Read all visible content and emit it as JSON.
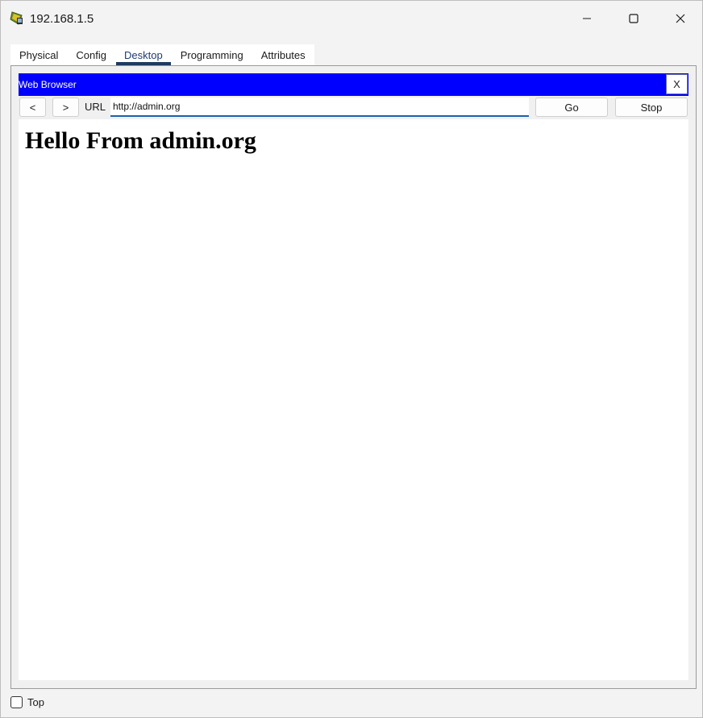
{
  "window": {
    "title": "192.168.1.5",
    "icon": "packet-tracer-pc-icon"
  },
  "window_controls": {
    "minimize_icon": "minimize-icon",
    "maximize_icon": "maximize-icon",
    "close_icon": "close-icon"
  },
  "tabs": [
    {
      "label": "Physical",
      "active": false
    },
    {
      "label": "Config",
      "active": false
    },
    {
      "label": "Desktop",
      "active": true
    },
    {
      "label": "Programming",
      "active": false
    },
    {
      "label": "Attributes",
      "active": false
    }
  ],
  "browser": {
    "title": "Web Browser",
    "close_label": "X",
    "header_color": "#0000ff",
    "back_label": "<",
    "forward_label": ">",
    "url_label": "URL",
    "url_value": "http://admin.org",
    "go_label": "Go",
    "stop_label": "Stop"
  },
  "page": {
    "heading": "Hello From admin.org"
  },
  "footer": {
    "top_label": "Top",
    "top_checked": false
  }
}
